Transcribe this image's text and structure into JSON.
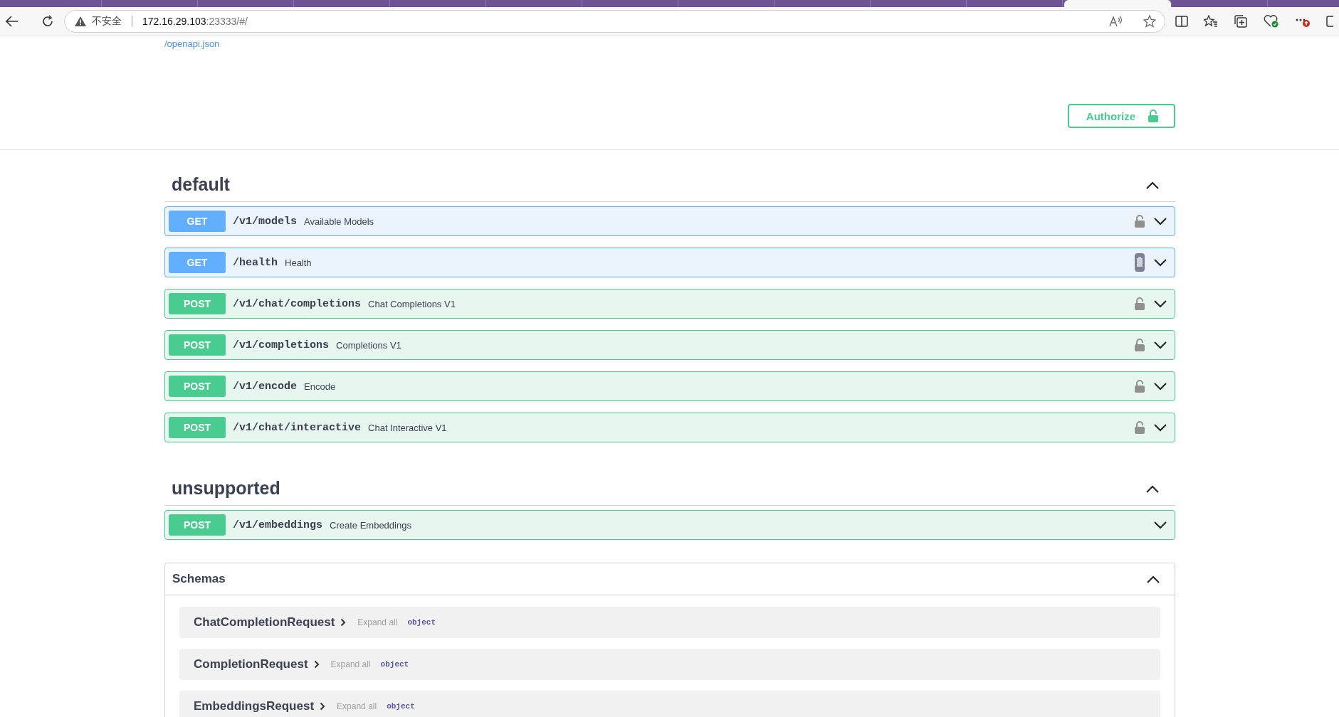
{
  "browser": {
    "tabs": [
      {
        "selected": false
      },
      {
        "selected": false
      },
      {
        "selected": false
      },
      {
        "selected": false
      },
      {
        "selected": false
      },
      {
        "selected": false
      },
      {
        "selected": false
      },
      {
        "selected": false
      },
      {
        "selected": false
      },
      {
        "selected": false
      },
      {
        "selected": false
      },
      {
        "selected": true
      },
      {
        "selected": false
      }
    ],
    "security": "不安全",
    "host": "172.16.29.103",
    "address_rest": ":23333/#/"
  },
  "spec_link": "/openapi.json",
  "authorize": "Authorize",
  "sections": [
    {
      "title": "default",
      "expanded": true,
      "operations": [
        {
          "method": "GET",
          "path": "/v1/models",
          "summary": "Available Models",
          "kind": "lock"
        },
        {
          "method": "GET",
          "path": "/health",
          "summary": "Health",
          "kind": "clipboard"
        },
        {
          "method": "POST",
          "path": "/v1/chat/completions",
          "summary": "Chat Completions V1",
          "kind": "lock"
        },
        {
          "method": "POST",
          "path": "/v1/completions",
          "summary": "Completions V1",
          "kind": "lock"
        },
        {
          "method": "POST",
          "path": "/v1/encode",
          "summary": "Encode",
          "kind": "lock"
        },
        {
          "method": "POST",
          "path": "/v1/chat/interactive",
          "summary": "Chat Interactive V1",
          "kind": "lock"
        }
      ]
    },
    {
      "title": "unsupported",
      "expanded": true,
      "operations": [
        {
          "method": "POST",
          "path": "/v1/embeddings",
          "summary": "Create Embeddings",
          "kind": "plain"
        }
      ]
    }
  ],
  "schemas": {
    "title": "Schemas",
    "expanded": true,
    "models": [
      {
        "name": "ChatCompletionRequest",
        "expand": "Expand all",
        "type": "object"
      },
      {
        "name": "CompletionRequest",
        "expand": "Expand all",
        "type": "object"
      },
      {
        "name": "EmbeddingsRequest",
        "expand": "Expand all",
        "type": "object"
      }
    ]
  }
}
